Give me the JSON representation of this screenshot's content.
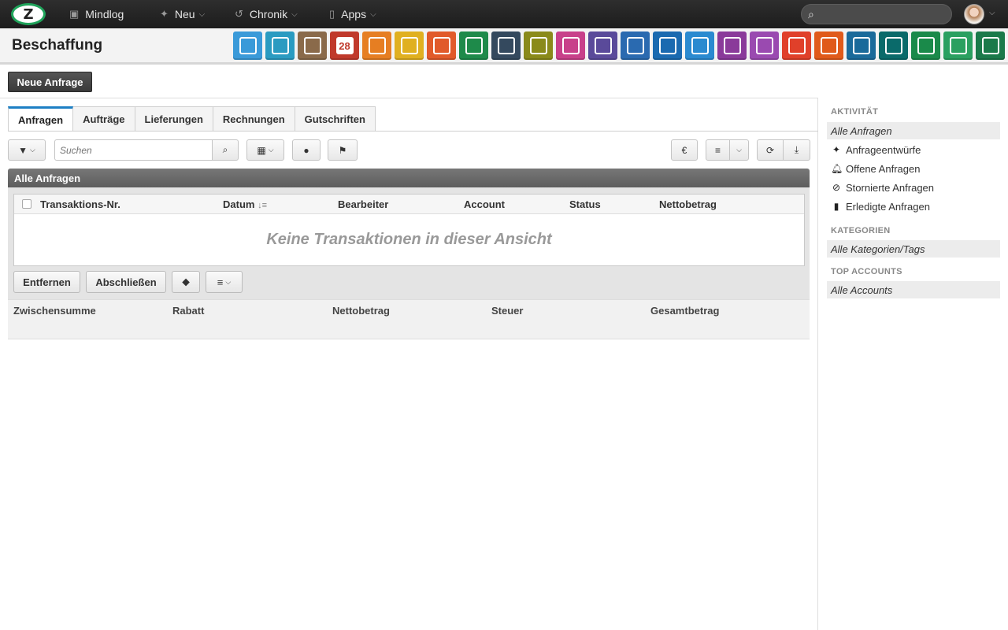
{
  "nav": {
    "items": [
      {
        "label": "Mindlog",
        "icon": "monitor-icon"
      },
      {
        "label": "Neu",
        "icon": "sparkle-icon"
      },
      {
        "label": "Chronik",
        "icon": "history-icon"
      },
      {
        "label": "Apps",
        "icon": "tablet-icon"
      }
    ]
  },
  "header": {
    "title": "Beschaffung",
    "apps": [
      {
        "name": "mail",
        "color": "#3a9ad9"
      },
      {
        "name": "address-book",
        "color": "#2a9bc1"
      },
      {
        "name": "contacts",
        "color": "#8a6a4a"
      },
      {
        "name": "calendar",
        "color": "#c0392b",
        "text": "28"
      },
      {
        "name": "timer",
        "color": "#e67e22"
      },
      {
        "name": "tasks",
        "color": "#e0b020"
      },
      {
        "name": "projects",
        "color": "#e15a2a"
      },
      {
        "name": "notes",
        "color": "#1e8a4a"
      },
      {
        "name": "bookmarks",
        "color": "#34495e"
      },
      {
        "name": "documents",
        "color": "#8a8a1a"
      },
      {
        "name": "cashier",
        "color": "#c8408a"
      },
      {
        "name": "finance",
        "color": "#5a4a9a"
      },
      {
        "name": "shipping",
        "color": "#2a6ab0"
      },
      {
        "name": "support",
        "color": "#1a6ab0"
      },
      {
        "name": "money-bag",
        "color": "#2a8ad0"
      },
      {
        "name": "contracts",
        "color": "#8a3a9a"
      },
      {
        "name": "deals",
        "color": "#9a4ab0"
      },
      {
        "name": "pdf",
        "color": "#e0402a"
      },
      {
        "name": "broadcast",
        "color": "#e05a1a"
      },
      {
        "name": "download",
        "color": "#1a6a9a"
      },
      {
        "name": "cart",
        "color": "#0a6a6a"
      },
      {
        "name": "cash",
        "color": "#1a8a4a"
      },
      {
        "name": "price-tag",
        "color": "#2aa060"
      },
      {
        "name": "database",
        "color": "#1a7a4a"
      }
    ]
  },
  "actions": {
    "new_request": "Neue Anfrage"
  },
  "tabs": [
    {
      "label": "Anfragen",
      "active": true
    },
    {
      "label": "Aufträge"
    },
    {
      "label": "Lieferungen"
    },
    {
      "label": "Rechnungen"
    },
    {
      "label": "Gutschriften"
    }
  ],
  "toolbar": {
    "search_placeholder": "Suchen",
    "currency": "€"
  },
  "panel": {
    "title": "Alle Anfragen",
    "columns": [
      "Transaktions-Nr.",
      "Datum",
      "Bearbeiter",
      "Account",
      "Status",
      "Nettobetrag"
    ],
    "empty": "Keine Transaktionen in dieser Ansicht"
  },
  "bulk": {
    "remove": "Entfernen",
    "complete": "Abschließen"
  },
  "totals": [
    "Zwischensumme",
    "Rabatt",
    "Nettobetrag",
    "Steuer",
    "Gesamtbetrag"
  ],
  "sidebar": {
    "activity_title": "AKTIVITÄT",
    "activity_selected": "Alle Anfragen",
    "activity_items": [
      {
        "label": "Anfrageentwürfe",
        "icon": "sparkle-icon"
      },
      {
        "label": "Offene Anfragen",
        "icon": "bell-icon"
      },
      {
        "label": "Stornierte Anfragen",
        "icon": "ban-icon"
      },
      {
        "label": "Erledigte Anfragen",
        "icon": "book-icon"
      }
    ],
    "categories_title": "KATEGORIEN",
    "categories_selected": "Alle Kategorien/Tags",
    "accounts_title": "TOP ACCOUNTS",
    "accounts_selected": "Alle Accounts"
  }
}
